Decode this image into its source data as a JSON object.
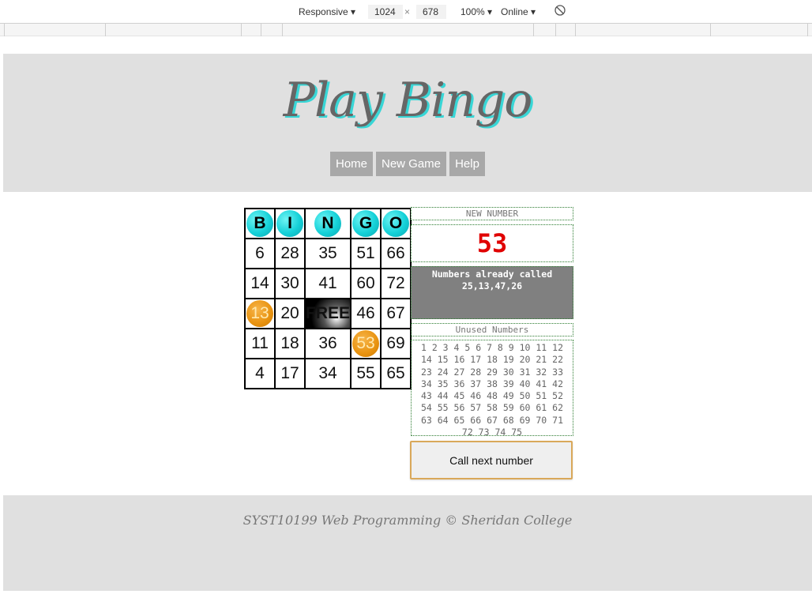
{
  "devtools": {
    "device": "Responsive",
    "width": "1024",
    "times": "×",
    "height": "678",
    "zoom": "100%",
    "network": "Online"
  },
  "header": {
    "title": "Play Bingo",
    "nav": [
      "Home",
      "New Game",
      "Help"
    ]
  },
  "card": {
    "letters": [
      "B",
      "I",
      "N",
      "G",
      "O"
    ],
    "rows": [
      [
        "6",
        "28",
        "35",
        "51",
        "66"
      ],
      [
        "14",
        "30",
        "41",
        "60",
        "72"
      ],
      [
        "13",
        "20",
        "FREE",
        "46",
        "67"
      ],
      [
        "11",
        "18",
        "36",
        "53",
        "69"
      ],
      [
        "4",
        "17",
        "34",
        "55",
        "65"
      ]
    ],
    "marked": [
      "13",
      "53"
    ]
  },
  "panel": {
    "new_number_label": "NEW NUMBER",
    "new_number": "53",
    "called_label": "Numbers already called",
    "called_values": "25,13,47,26",
    "unused_label": "Unused Numbers",
    "unused": "1 2 3 4 5 6 7 8 9 10 11 12 14 15 16 17 18 19 20 21 22 23 24 27 28 29 30 31 32 33 34 35 36 37 38 39 40 41 42 43 44 45 46 48 49 50 51 52 54 55 56 57 58 59 60 61 62 63 64 65 66 67 68 69 70 71 72 73 74 75",
    "call_button": "Call next number"
  },
  "footer": {
    "text": "SYST10199 Web Programming © Sheridan College"
  },
  "colors": {
    "header_bg": "#e0e0e0",
    "title_shadow": "#38d6d6",
    "nav_bg": "#a8a8a8",
    "new_number": "#e00000",
    "ball_cyan": "#15d1d8",
    "marked_orange": "#e8920f"
  }
}
